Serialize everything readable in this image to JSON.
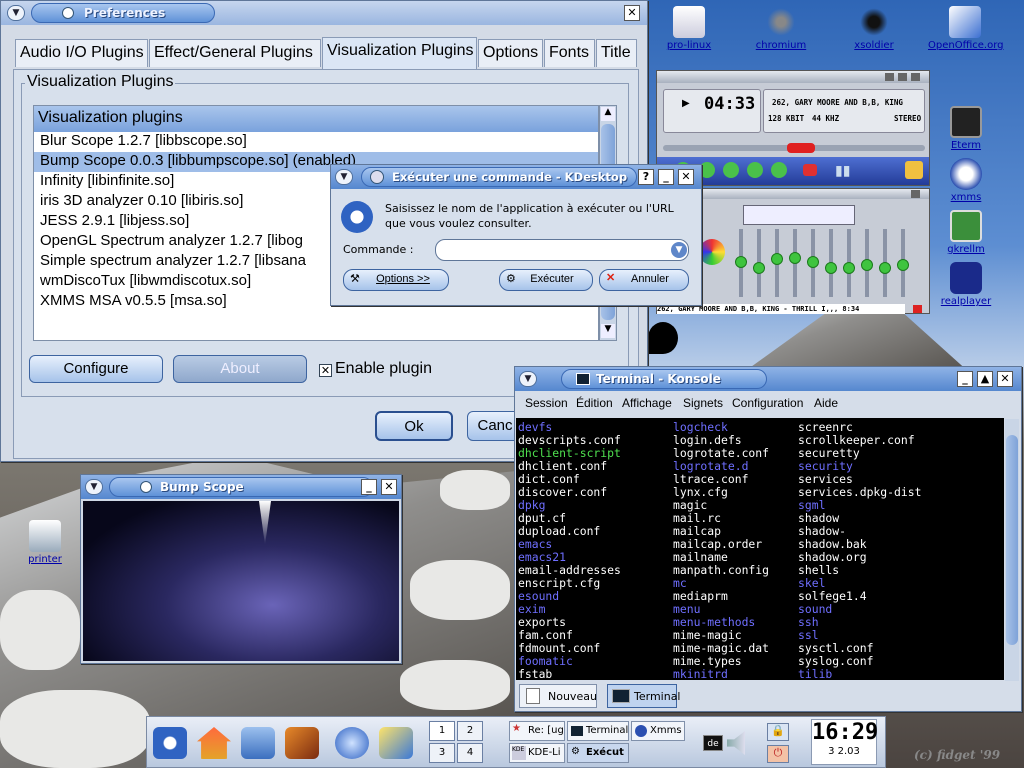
{
  "desktop": {
    "icons_top": [
      {
        "label": "pro-linux"
      },
      {
        "label": "chromium"
      },
      {
        "label": "xsoldier"
      },
      {
        "label": "OpenOffice.org"
      }
    ],
    "icons_right": [
      {
        "label": "Eterm"
      },
      {
        "label": "xmms"
      },
      {
        "label": "gkrellm"
      },
      {
        "label": "realplayer"
      }
    ],
    "printer_label": "printer",
    "credit": "(c) fidget '99"
  },
  "prefs": {
    "title": "Preferences",
    "tabs": [
      "Audio I/O Plugins",
      "Effect/General Plugins",
      "Visualization Plugins",
      "Options",
      "Fonts",
      "Title"
    ],
    "group_label": "Visualization Plugins",
    "list_header": "Visualization plugins",
    "plugins": [
      "Blur Scope 1.2.7    [libbscope.so]",
      "Bump Scope 0.0.3    [libbumpscope.so] (enabled)",
      "Infinity    [libinfinite.so]",
      "iris 3D analyzer 0.10    [libiris.so]",
      "JESS 2.9.1    [libjess.so]",
      "OpenGL Spectrum analyzer 1.2.7    [libog",
      "Simple spectrum analyzer 1.2.7    [libsana",
      "wmDiscoTux    [libwmdiscotux.so]",
      "XMMS MSA v0.5.5    [msa.so]"
    ],
    "configure_label": "Configure",
    "about_label": "About",
    "enable_label": "Enable plugin",
    "enable_checked": true,
    "ok_label": "Ok",
    "cancel_label": "Canc"
  },
  "xmms": {
    "time": "04:33",
    "song": "262, GARY MOORE AND B,B, KING",
    "kbit": "128 KBIT",
    "khz": "44 KHZ",
    "stereo": "STEREO",
    "playlist_song": "262, GARY MOORE AND B,B, KING - THRILL I,,, 8:34",
    "eq_levels": [
      0.55,
      0.45,
      0.6,
      0.62,
      0.55,
      0.45,
      0.45,
      0.5,
      0.45,
      0.5
    ]
  },
  "run": {
    "title": "Exécuter une commande - KDesktop",
    "message": "Saisissez le nom de l'application à exécuter ou l'URL que vous voulez consulter.",
    "command_label": "Commande :",
    "command_value": "",
    "options_label": "Options >>",
    "run_label": "Exécuter",
    "cancel_label": "Annuler"
  },
  "bump": {
    "title": "Bump Scope"
  },
  "konsole": {
    "title": "Terminal - Konsole",
    "menu": [
      "Session",
      "Édition",
      "Affichage",
      "Signets",
      "Configuration",
      "Aide"
    ],
    "columns": [
      [
        [
          "devfs",
          "#6f6fff"
        ],
        [
          "devscripts.conf",
          "#ffffff"
        ],
        [
          "dhclient-script",
          "#4fe04f"
        ],
        [
          "dhclient.conf",
          "#ffffff"
        ],
        [
          "dict.conf",
          "#ffffff"
        ],
        [
          "discover.conf",
          "#ffffff"
        ],
        [
          "dpkg",
          "#6f6fff"
        ],
        [
          "dput.cf",
          "#ffffff"
        ],
        [
          "dupload.conf",
          "#ffffff"
        ],
        [
          "emacs",
          "#6f6fff"
        ],
        [
          "emacs21",
          "#6f6fff"
        ],
        [
          "email-addresses",
          "#ffffff"
        ],
        [
          "enscript.cfg",
          "#ffffff"
        ],
        [
          "esound",
          "#6f6fff"
        ],
        [
          "exim",
          "#6f6fff"
        ],
        [
          "exports",
          "#ffffff"
        ],
        [
          "fam.conf",
          "#ffffff"
        ],
        [
          "fdmount.conf",
          "#ffffff"
        ],
        [
          "foomatic",
          "#6f6fff"
        ],
        [
          "fstab",
          "#ffffff"
        ]
      ],
      [
        [
          "logcheck",
          "#6f6fff"
        ],
        [
          "login.defs",
          "#ffffff"
        ],
        [
          "logrotate.conf",
          "#ffffff"
        ],
        [
          "logrotate.d",
          "#6f6fff"
        ],
        [
          "ltrace.conf",
          "#ffffff"
        ],
        [
          "lynx.cfg",
          "#ffffff"
        ],
        [
          "magic",
          "#ffffff"
        ],
        [
          "mail.rc",
          "#ffffff"
        ],
        [
          "mailcap",
          "#ffffff"
        ],
        [
          "mailcap.order",
          "#ffffff"
        ],
        [
          "mailname",
          "#ffffff"
        ],
        [
          "manpath.config",
          "#ffffff"
        ],
        [
          "mc",
          "#6f6fff"
        ],
        [
          "mediaprm",
          "#ffffff"
        ],
        [
          "menu",
          "#6f6fff"
        ],
        [
          "menu-methods",
          "#6f6fff"
        ],
        [
          "mime-magic",
          "#ffffff"
        ],
        [
          "mime-magic.dat",
          "#ffffff"
        ],
        [
          "mime.types",
          "#ffffff"
        ],
        [
          "mkinitrd",
          "#6f6fff"
        ]
      ],
      [
        [
          "screenrc",
          "#ffffff"
        ],
        [
          "scrollkeeper.conf",
          "#ffffff"
        ],
        [
          "securetty",
          "#ffffff"
        ],
        [
          "security",
          "#6f6fff"
        ],
        [
          "services",
          "#ffffff"
        ],
        [
          "services.dpkg-dist",
          "#ffffff"
        ],
        [
          "sgml",
          "#6f6fff"
        ],
        [
          "shadow",
          "#ffffff"
        ],
        [
          "shadow-",
          "#ffffff"
        ],
        [
          "shadow.bak",
          "#ffffff"
        ],
        [
          "shadow.org",
          "#ffffff"
        ],
        [
          "shells",
          "#ffffff"
        ],
        [
          "skel",
          "#6f6fff"
        ],
        [
          "solfege1.4",
          "#ffffff"
        ],
        [
          "sound",
          "#6f6fff"
        ],
        [
          "ssh",
          "#6f6fff"
        ],
        [
          "ssl",
          "#6f6fff"
        ],
        [
          "sysctl.conf",
          "#ffffff"
        ],
        [
          "syslog.conf",
          "#ffffff"
        ],
        [
          "tilib",
          "#6f6fff"
        ]
      ]
    ],
    "new_tab_label": "Nouveau",
    "terminal_tab_label": "Terminal"
  },
  "taskbar": {
    "pager": [
      "1",
      "2",
      "3",
      "4"
    ],
    "tasks": [
      "Re: [ugd",
      "Terminal",
      "Xmms",
      "KDE-Li",
      "Exécut"
    ],
    "clock": "16:29",
    "date": "3 2.03"
  }
}
